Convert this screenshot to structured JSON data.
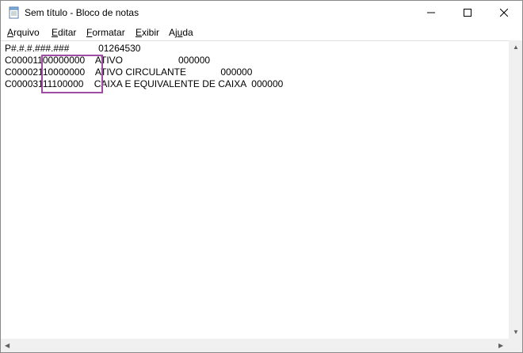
{
  "window": {
    "title": "Sem título - Bloco de notas"
  },
  "menu": {
    "items": [
      {
        "label_first": "A",
        "label_rest": "rquivo"
      },
      {
        "label_first": "E",
        "label_rest": "ditar"
      },
      {
        "label_first": "F",
        "label_rest": "ormatar"
      },
      {
        "label_first": "E",
        "label_rest": "xibir"
      },
      {
        "label_pre": "Aj",
        "label_first": "u",
        "label_rest": "da"
      }
    ]
  },
  "editor": {
    "lines": [
      "P#.#.#.###.###           01264530",
      "C00001100000000    ATIVO                     000000",
      "C00002110000000    ATIVO CIRCULANTE             000000",
      "C00003111100000    CAIXA E EQUIVALENTE DE CAIXA  000000"
    ]
  },
  "colors": {
    "highlight": "#a04ca4"
  },
  "icons": {
    "app": "notepad-icon",
    "minimize": "minimize-icon",
    "maximize": "maximize-icon",
    "close": "close-icon"
  }
}
